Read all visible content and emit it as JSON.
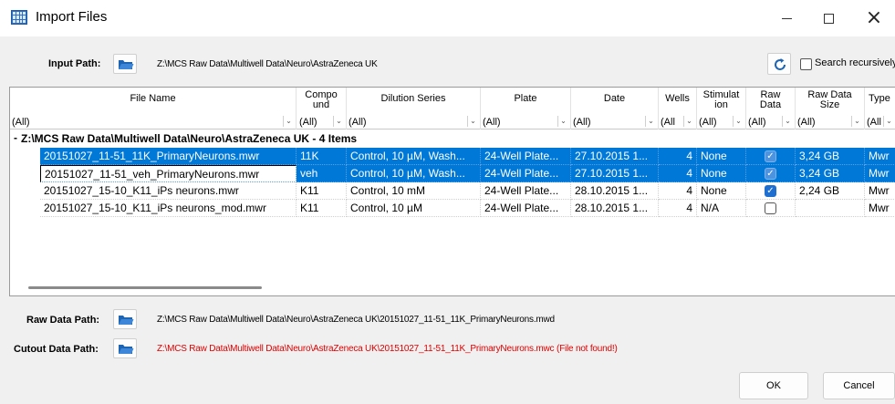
{
  "window": {
    "title": "Import Files",
    "icon": "grid-table-icon",
    "controls": [
      "minimize-icon",
      "maximize-icon",
      "close-icon"
    ]
  },
  "input_path": {
    "label": "Input Path:",
    "value": "Z:\\MCS Raw Data\\Multiwell Data\\Neuro\\AstraZeneca UK",
    "icon": "folder-open-icon"
  },
  "search": {
    "refresh_icon": "refresh-icon",
    "recursive_label": "Search recursively",
    "recursive_checked": false
  },
  "grid": {
    "columns": [
      {
        "title": "File Name",
        "filter": "(All)"
      },
      {
        "title": "Compo\nund",
        "filter": "(All)"
      },
      {
        "title": "Dilution Series",
        "filter": "(All)"
      },
      {
        "title": "Plate",
        "filter": "(All)"
      },
      {
        "title": "Date",
        "filter": "(All)"
      },
      {
        "title": "Wells",
        "filter": "(All"
      },
      {
        "title": "Stimulat\nion",
        "filter": "(All)"
      },
      {
        "title": "Raw\nData",
        "filter": "(All)"
      },
      {
        "title": "Raw Data\nSize",
        "filter": "(All)"
      },
      {
        "title": "Type",
        "filter": "(All"
      }
    ],
    "group": {
      "toggle": "-",
      "title": "Z:\\MCS Raw Data\\Multiwell Data\\Neuro\\AstraZeneca UK - 4 Items"
    },
    "rows": [
      {
        "file": "20151027_11-51_11K_PrimaryNeurons.mwr",
        "compound": "11K",
        "dilution": "Control, 10 µM, Wash...",
        "plate": "24-Well Plate...",
        "date": "27.10.2015 1...",
        "wells": "4",
        "stimulation": "None",
        "raw_data": true,
        "size": "3,24 GB",
        "type": "Mwr",
        "selected": true
      },
      {
        "file": "20151027_11-51_veh_PrimaryNeurons.mwr",
        "compound": "veh",
        "dilution": "Control, 10 µM, Wash...",
        "plate": "24-Well Plate...",
        "date": "27.10.2015 1...",
        "wells": "4",
        "stimulation": "None",
        "raw_data": true,
        "size": "3,24 GB",
        "type": "Mwr",
        "selected": true
      },
      {
        "file": "20151027_15-10_K11_iPs neurons.mwr",
        "compound": "K11",
        "dilution": "Control, 10 mM",
        "plate": "24-Well Plate...",
        "date": "28.10.2015 1...",
        "wells": "4",
        "stimulation": "None",
        "raw_data": true,
        "size": "2,24 GB",
        "type": "Mwr",
        "selected": false
      },
      {
        "file": "20151027_15-10_K11_iPs neurons_mod.mwr",
        "compound": "K11",
        "dilution": "Control, 10 µM",
        "plate": "24-Well Plate...",
        "date": "28.10.2015 1...",
        "wells": "4",
        "stimulation": "N/A",
        "raw_data": false,
        "size": "",
        "type": "Mwr",
        "selected": false
      }
    ]
  },
  "raw_data_path": {
    "label": "Raw Data Path:",
    "value": "Z:\\MCS Raw Data\\Multiwell Data\\Neuro\\AstraZeneca UK\\20151027_11-51_11K_PrimaryNeurons.mwd"
  },
  "cutout_data_path": {
    "label": "Cutout Data Path:",
    "value": "Z:\\MCS Raw Data\\Multiwell Data\\Neuro\\AstraZeneca UK\\20151027_11-51_11K_PrimaryNeurons.mwc (File not found!)",
    "error_color": "#e00000"
  },
  "buttons": {
    "ok": "OK",
    "cancel": "Cancel"
  },
  "colors": {
    "selection": "#0078d7",
    "checkbox_on": "#1f6fd1",
    "folder": "#1e64b4"
  }
}
